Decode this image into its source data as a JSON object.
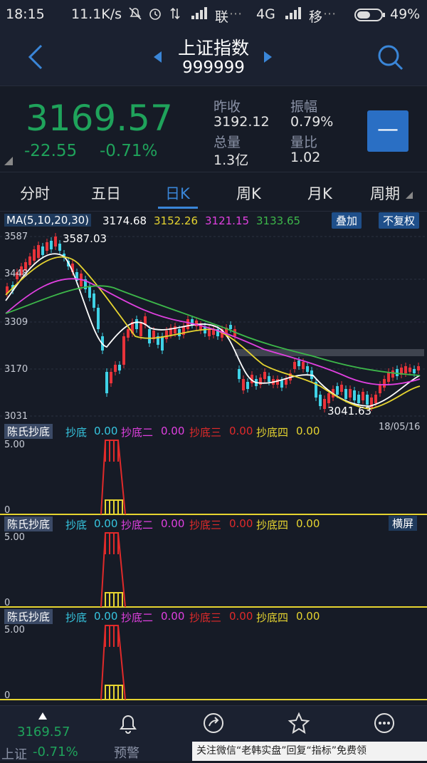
{
  "status_bar": {
    "time": "18:15",
    "speed": "11.1K/s",
    "carrier1": "联",
    "network": "4G",
    "carrier2": "移",
    "battery": "49%"
  },
  "header": {
    "title": "上证指数",
    "code": "999999"
  },
  "quote": {
    "price": "3169.57",
    "change": "-22.55",
    "change_pct": "-0.71%",
    "prev_close_label": "昨收",
    "prev_close": "3192.12",
    "amplitude_label": "振幅",
    "amplitude": "0.79%",
    "volume_label": "总量",
    "volume": "1.3亿",
    "ratio_label": "量比",
    "ratio": "1.02",
    "minus_symbol": "—"
  },
  "tabs": [
    "分时",
    "五日",
    "日K",
    "周K",
    "月K",
    "周期"
  ],
  "active_tab": "日K",
  "ma_bar": {
    "label": "MA(5,10,20,30)",
    "ma5": "3174.68",
    "ma10": "3152.26",
    "ma20": "3121.15",
    "ma30": "3133.65",
    "overlay_btn": "叠加",
    "adjust_btn": "不复权"
  },
  "kchart": {
    "y_ticks": [
      "3587",
      "3448",
      "3309",
      "3170",
      "3031"
    ],
    "high_label": "3587.03",
    "low_label": "3041.63",
    "date_label": "18/05/16"
  },
  "indicator": {
    "name": "陈氏抄底",
    "items": [
      {
        "label": "抄底",
        "value": "0.00",
        "color": "#36c6e0"
      },
      {
        "label": "抄底二",
        "value": "0.00",
        "color": "#e040e0"
      },
      {
        "label": "抄底三",
        "value": "0.00",
        "color": "#e02a2a"
      },
      {
        "label": "抄底四",
        "value": "0.00",
        "color": "#e6d430"
      }
    ],
    "y_top": "5.00",
    "y_bottom": "0",
    "landscape_btn": "横屏"
  },
  "bottom_nav": {
    "index_price": "3169.57",
    "index_name": "上证",
    "index_change": "-0.71%",
    "alert_label": "预警"
  },
  "watermark": "关注微信“老韩实盘”回复“指标”免费领",
  "colors": {
    "up": "#e8333a",
    "down": "#1fa35b",
    "cyan": "#3fd2e6",
    "accent": "#3a86d8"
  }
}
